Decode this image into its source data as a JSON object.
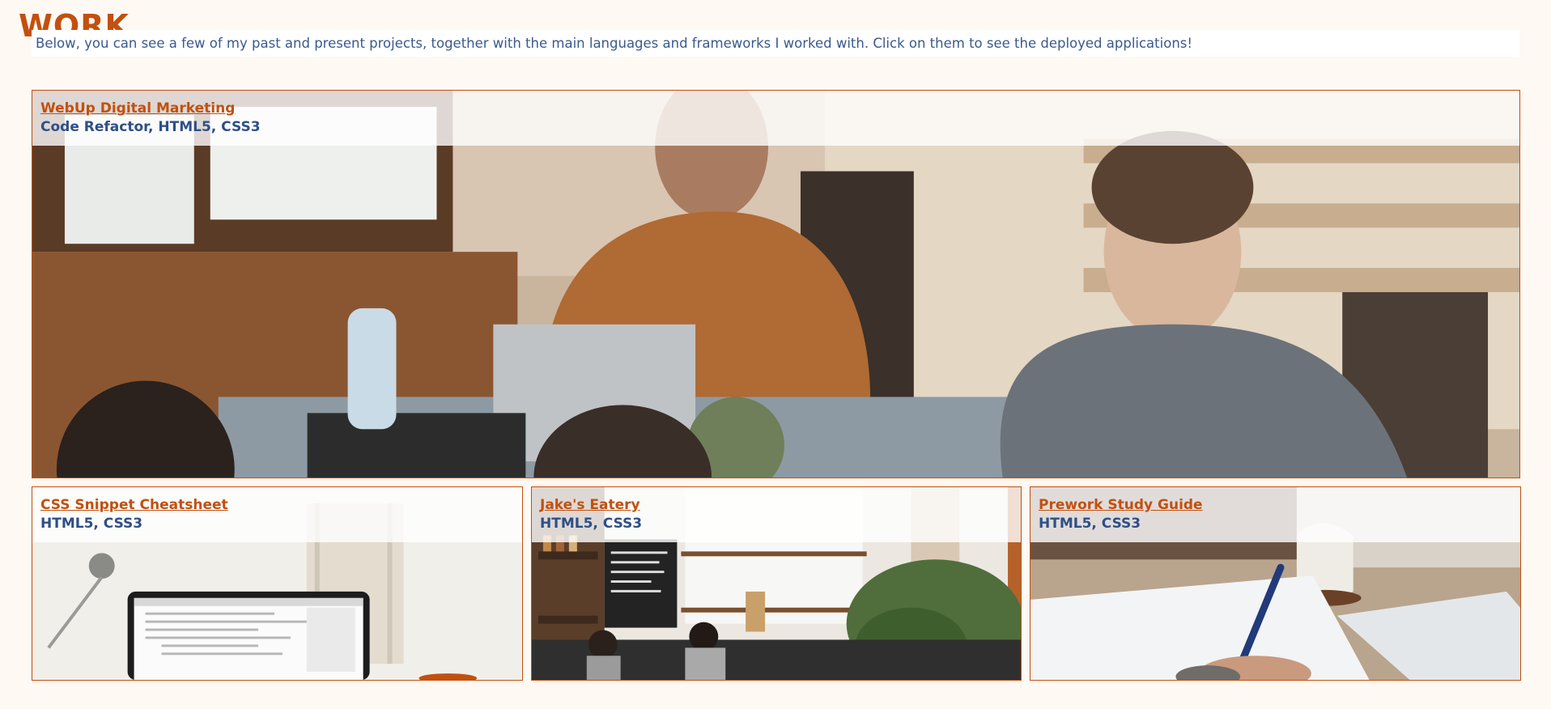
{
  "work": {
    "title": "WORK",
    "intro": "Below, you can see a few of my past and present projects, together with the main languages and frameworks I worked with. Click on them to see the deployed applications!"
  },
  "projects": [
    {
      "name": "WebUp Digital Marketing",
      "tech": "Code Refactor, HTML5, CSS3",
      "image": "team-meeting-photo"
    },
    {
      "name": "CSS Snippet Cheatsheet",
      "tech": "HTML5, CSS3",
      "image": "laptop-code-photo"
    },
    {
      "name": "Jake's Eatery",
      "tech": "HTML5, CSS3",
      "image": "cafe-counter-photo"
    },
    {
      "name": "Prework Study Guide",
      "tech": "HTML5, CSS3",
      "image": "writing-notes-photo"
    }
  ],
  "colors": {
    "accent": "#c2500f",
    "tech_text": "#2f4f86",
    "intro_text": "#3a5a8c",
    "background": "#fef9f3"
  }
}
